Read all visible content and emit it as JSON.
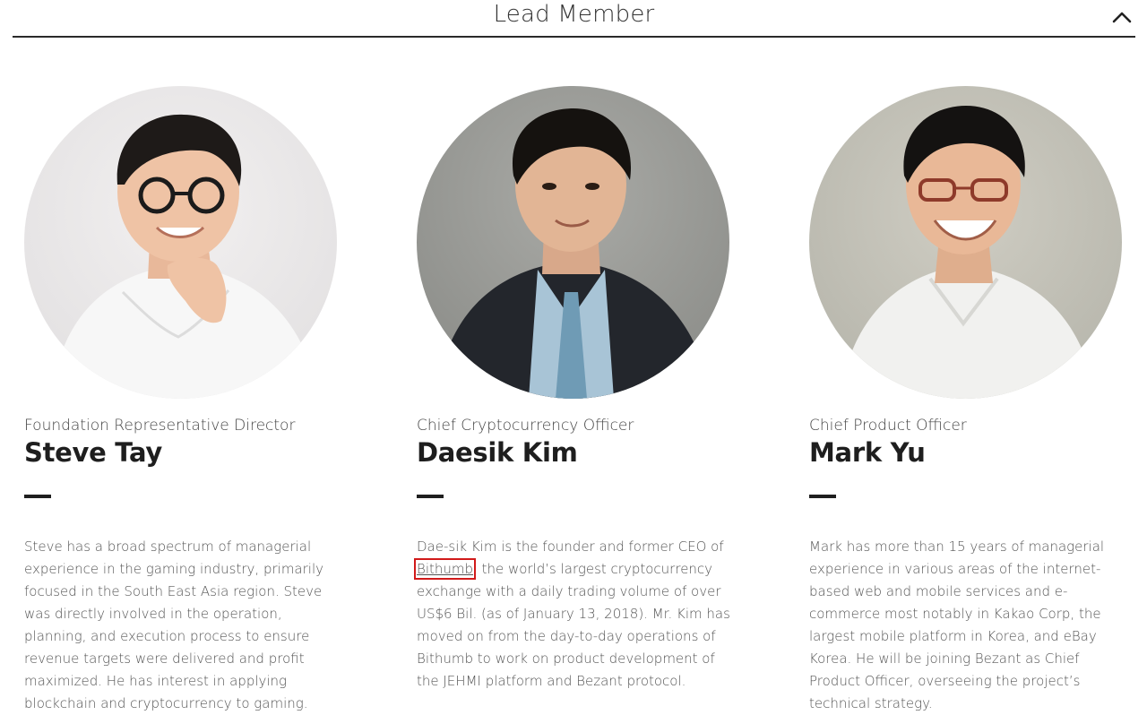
{
  "section": {
    "title": "Lead Member",
    "toggle_icon": "chevron-up-icon"
  },
  "members": [
    {
      "role": "Foundation Representative Director",
      "name": "Steve Tay",
      "bio": "Steve has a broad spectrum of managerial experience in the gaming industry, primarily focused in the South East Asia region. Steve was directly involved in the operation, planning, and execution process to ensure revenue targets were delivered and profit maximized. He has interest in applying blockchain and cryptocurrency to gaming."
    },
    {
      "role": "Chief Cryptocurrency Officer",
      "name": "Daesik Kim",
      "bio_before": "Dae-sik Kim is the founder and former CEO of ",
      "bio_link": "Bithumb",
      "bio_after": ", the world’s largest cryptocurrency exchange with a daily trading volume of over US$6 Bil. (as of January 13, 2018). Mr. Kim has moved on from the day-to-day operations of Bithumb to work on product development of the JEHMI platform and Bezant protocol."
    },
    {
      "role": "Chief Product Officer",
      "name": "Mark Yu",
      "bio": "Mark has more than 15 years of managerial experience in various areas of the internet-based web and mobile services and e-commerce most notably in Kakao Corp, the largest mobile platform in Korea, and eBay Korea. He will be joining Bezant as Chief Product Officer, overseeing the project’s technical strategy."
    }
  ]
}
